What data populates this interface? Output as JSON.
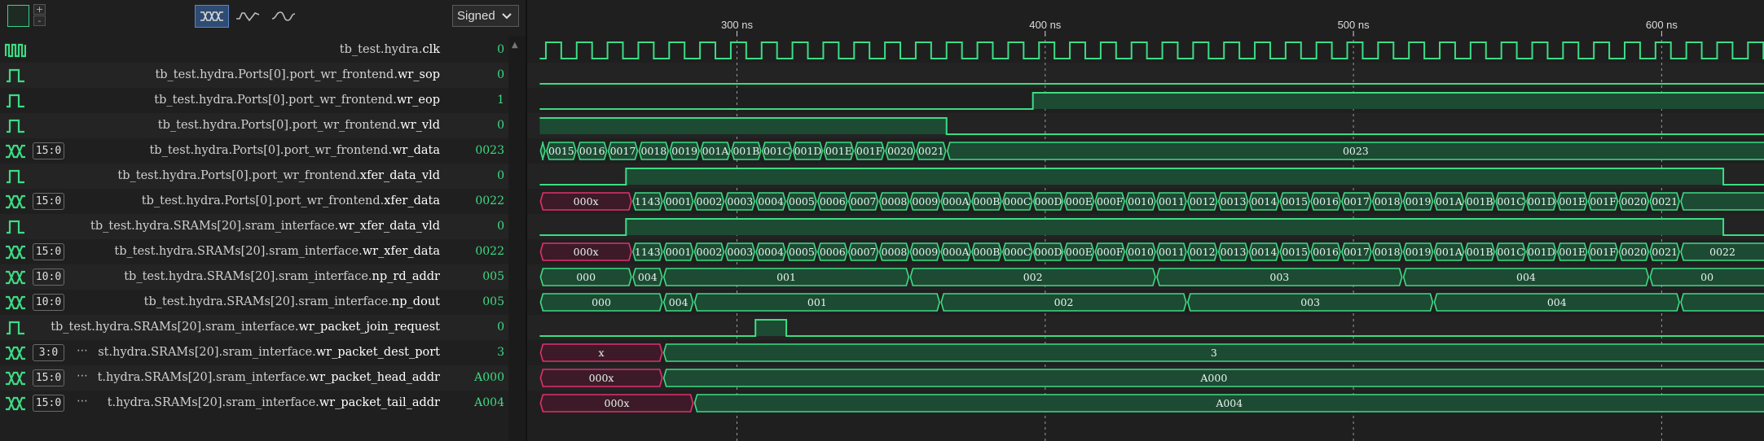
{
  "toolbar": {
    "swatch_color": "#39d38a",
    "plus_label": "+",
    "minus_label": "-",
    "modes": [
      {
        "icon": "bus-hex-icon",
        "active": true
      },
      {
        "icon": "analog-step-icon",
        "active": false
      },
      {
        "icon": "analog-smooth-icon",
        "active": false
      }
    ],
    "radix_select": "Signed"
  },
  "timeline": {
    "ticks": [
      {
        "label": "300 ns",
        "time": 300
      },
      {
        "label": "400 ns",
        "time": 400
      },
      {
        "label": "500 ns",
        "time": 500
      },
      {
        "label": "600 ns",
        "time": 600
      }
    ],
    "clock_period_ns": 10
  },
  "colors": {
    "wave": "#3ddc84",
    "bus_fill": "#1d4a33",
    "undefined": "#e0306e",
    "undefined_fill": "#3d1a27"
  },
  "signals": [
    {
      "name_prefix": "tb_test.hydra.",
      "name_leaf": "clk",
      "value": "0",
      "kind": "clock",
      "range": ""
    },
    {
      "name_prefix": "tb_test.hydra.Ports[0].port_wr_frontend.",
      "name_leaf": "wr_sop",
      "value": "0",
      "kind": "bit",
      "range": ""
    },
    {
      "name_prefix": "tb_test.hydra.Ports[0].port_wr_frontend.",
      "name_leaf": "wr_eop",
      "value": "1",
      "kind": "bit",
      "range": ""
    },
    {
      "name_prefix": "tb_test.hydra.Ports[0].port_wr_frontend.",
      "name_leaf": "wr_vld",
      "value": "0",
      "kind": "bit",
      "range": ""
    },
    {
      "name_prefix": "tb_test.hydra.Ports[0].port_wr_frontend.",
      "name_leaf": "wr_data",
      "value": "0023",
      "kind": "bus",
      "range": "15:0"
    },
    {
      "name_prefix": "tb_test.hydra.Ports[0].port_wr_frontend.",
      "name_leaf": "xfer_data_vld",
      "value": "0",
      "kind": "bit",
      "range": ""
    },
    {
      "name_prefix": "tb_test.hydra.Ports[0].port_wr_frontend.",
      "name_leaf": "xfer_data",
      "value": "0022",
      "kind": "bus",
      "range": "15:0"
    },
    {
      "name_prefix": "tb_test.hydra.SRAMs[20].sram_interface.",
      "name_leaf": "wr_xfer_data_vld",
      "value": "0",
      "kind": "bit",
      "range": ""
    },
    {
      "name_prefix": "tb_test.hydra.SRAMs[20].sram_interface.",
      "name_leaf": "wr_xfer_data",
      "value": "0022",
      "kind": "bus",
      "range": "15:0"
    },
    {
      "name_prefix": "tb_test.hydra.SRAMs[20].sram_interface.",
      "name_leaf": "np_rd_addr",
      "value": "005",
      "kind": "bus",
      "range": "10:0"
    },
    {
      "name_prefix": "tb_test.hydra.SRAMs[20].sram_interface.",
      "name_leaf": "np_dout",
      "value": "005",
      "kind": "bus",
      "range": "10:0"
    },
    {
      "name_prefix": "tb_test.hydra.SRAMs[20].sram_interface.",
      "name_leaf": "wr_packet_join_request",
      "value": "0",
      "kind": "bit",
      "range": ""
    },
    {
      "name_prefix": "st.hydra.SRAMs[20].sram_interface.",
      "name_leaf": "wr_packet_dest_port",
      "value": "3",
      "kind": "bus",
      "range": "3:0",
      "truncated": "⋯"
    },
    {
      "name_prefix": "t.hydra.SRAMs[20].sram_interface.",
      "name_leaf": "wr_packet_head_addr",
      "value": "A000",
      "kind": "bus",
      "range": "15:0",
      "truncated": "⋯"
    },
    {
      "name_prefix": "t.hydra.SRAMs[20].sram_interface.",
      "name_leaf": "wr_packet_tail_addr",
      "value": "A004",
      "kind": "bus",
      "range": "15:0",
      "truncated": "⋯"
    }
  ],
  "waves": {
    "wr_sop": {
      "initial": 0,
      "edges": []
    },
    "wr_eop": {
      "initial": 0,
      "edges": [
        396
      ]
    },
    "wr_vld": {
      "initial": 1,
      "edges": [
        368
      ]
    },
    "xfer_data_vld": {
      "initial": 0,
      "edges": [
        264,
        620
      ]
    },
    "wr_xfer_data_vld": {
      "initial": 0,
      "edges": [
        264,
        620
      ]
    },
    "wr_packet_join_request": {
      "initial": 0,
      "edges": [
        306,
        316
      ]
    },
    "wr_data": [
      {
        "t": 236,
        "v": ""
      },
      {
        "t": 238,
        "v": "0015"
      },
      {
        "t": 248,
        "v": "0016"
      },
      {
        "t": 258,
        "v": "0017"
      },
      {
        "t": 268,
        "v": "0018"
      },
      {
        "t": 278,
        "v": "0019"
      },
      {
        "t": 288,
        "v": "001A"
      },
      {
        "t": 298,
        "v": "001B"
      },
      {
        "t": 308,
        "v": "001C"
      },
      {
        "t": 318,
        "v": "001D"
      },
      {
        "t": 328,
        "v": "001E"
      },
      {
        "t": 338,
        "v": "001F"
      },
      {
        "t": 348,
        "v": "0020"
      },
      {
        "t": 358,
        "v": "0021"
      },
      {
        "t": 368,
        "v": "0023"
      }
    ],
    "wr_data_label_fix": {
      "0023_first": "0022"
    },
    "xfer_data": [
      {
        "t": 236,
        "v": "000x",
        "x": true
      },
      {
        "t": 266,
        "v": "1143"
      },
      {
        "t": 276,
        "v": "0001"
      },
      {
        "t": 286,
        "v": "0002"
      },
      {
        "t": 296,
        "v": "0003"
      },
      {
        "t": 306,
        "v": "0004"
      },
      {
        "t": 316,
        "v": "0005"
      },
      {
        "t": 326,
        "v": "0006"
      },
      {
        "t": 336,
        "v": "0007"
      },
      {
        "t": 346,
        "v": "0008"
      },
      {
        "t": 356,
        "v": "0009"
      },
      {
        "t": 366,
        "v": "000A"
      },
      {
        "t": 376,
        "v": "000B"
      },
      {
        "t": 386,
        "v": "000C"
      },
      {
        "t": 396,
        "v": "000D"
      },
      {
        "t": 406,
        "v": "000E"
      },
      {
        "t": 416,
        "v": "000F"
      },
      {
        "t": 426,
        "v": "0010"
      },
      {
        "t": 436,
        "v": "0011"
      },
      {
        "t": 446,
        "v": "0012"
      },
      {
        "t": 456,
        "v": "0013"
      },
      {
        "t": 466,
        "v": "0014"
      },
      {
        "t": 476,
        "v": "0015"
      },
      {
        "t": 486,
        "v": "0016"
      },
      {
        "t": 496,
        "v": "0017"
      },
      {
        "t": 506,
        "v": "0018"
      },
      {
        "t": 516,
        "v": "0019"
      },
      {
        "t": 526,
        "v": "001A"
      },
      {
        "t": 536,
        "v": "001B"
      },
      {
        "t": 546,
        "v": "001C"
      },
      {
        "t": 556,
        "v": "001D"
      },
      {
        "t": 566,
        "v": "001E"
      },
      {
        "t": 576,
        "v": "001F"
      },
      {
        "t": 586,
        "v": "0020"
      },
      {
        "t": 596,
        "v": "0021"
      },
      {
        "t": 606,
        "v": ""
      }
    ],
    "wr_xfer_data": [
      {
        "t": 236,
        "v": "000x",
        "x": true
      },
      {
        "t": 266,
        "v": "1143"
      },
      {
        "t": 276,
        "v": "0001"
      },
      {
        "t": 286,
        "v": "0002"
      },
      {
        "t": 296,
        "v": "0003"
      },
      {
        "t": 306,
        "v": "0004"
      },
      {
        "t": 316,
        "v": "0005"
      },
      {
        "t": 326,
        "v": "0006"
      },
      {
        "t": 336,
        "v": "0007"
      },
      {
        "t": 346,
        "v": "0008"
      },
      {
        "t": 356,
        "v": "0009"
      },
      {
        "t": 366,
        "v": "000A"
      },
      {
        "t": 376,
        "v": "000B"
      },
      {
        "t": 386,
        "v": "000C"
      },
      {
        "t": 396,
        "v": "000D"
      },
      {
        "t": 406,
        "v": "000E"
      },
      {
        "t": 416,
        "v": "000F"
      },
      {
        "t": 426,
        "v": "0010"
      },
      {
        "t": 436,
        "v": "0011"
      },
      {
        "t": 446,
        "v": "0012"
      },
      {
        "t": 456,
        "v": "0013"
      },
      {
        "t": 466,
        "v": "0014"
      },
      {
        "t": 476,
        "v": "0015"
      },
      {
        "t": 486,
        "v": "0016"
      },
      {
        "t": 496,
        "v": "0017"
      },
      {
        "t": 506,
        "v": "0018"
      },
      {
        "t": 516,
        "v": "0019"
      },
      {
        "t": 526,
        "v": "001A"
      },
      {
        "t": 536,
        "v": "001B"
      },
      {
        "t": 546,
        "v": "001C"
      },
      {
        "t": 556,
        "v": "001D"
      },
      {
        "t": 566,
        "v": "001E"
      },
      {
        "t": 576,
        "v": "001F"
      },
      {
        "t": 586,
        "v": "0020"
      },
      {
        "t": 596,
        "v": "0021"
      },
      {
        "t": 606,
        "v": "0022"
      }
    ],
    "np_rd_addr": [
      {
        "t": 236,
        "v": "000"
      },
      {
        "t": 266,
        "v": "004"
      },
      {
        "t": 276,
        "v": "001"
      },
      {
        "t": 356,
        "v": "002"
      },
      {
        "t": 436,
        "v": "003"
      },
      {
        "t": 516,
        "v": "004"
      },
      {
        "t": 596,
        "v": "00"
      }
    ],
    "np_dout": [
      {
        "t": 236,
        "v": "000"
      },
      {
        "t": 276,
        "v": "004"
      },
      {
        "t": 286,
        "v": "001"
      },
      {
        "t": 366,
        "v": "002"
      },
      {
        "t": 446,
        "v": "003"
      },
      {
        "t": 526,
        "v": "004"
      },
      {
        "t": 606,
        "v": ""
      }
    ],
    "wr_packet_dest_port": [
      {
        "t": 236,
        "v": "x",
        "x": true
      },
      {
        "t": 276,
        "v": "3"
      }
    ],
    "wr_packet_head_addr": [
      {
        "t": 236,
        "v": "000x",
        "x": true
      },
      {
        "t": 276,
        "v": "A000"
      }
    ],
    "wr_packet_tail_addr": [
      {
        "t": 236,
        "v": "000x",
        "x": true
      },
      {
        "t": 286,
        "v": "A004"
      }
    ]
  }
}
